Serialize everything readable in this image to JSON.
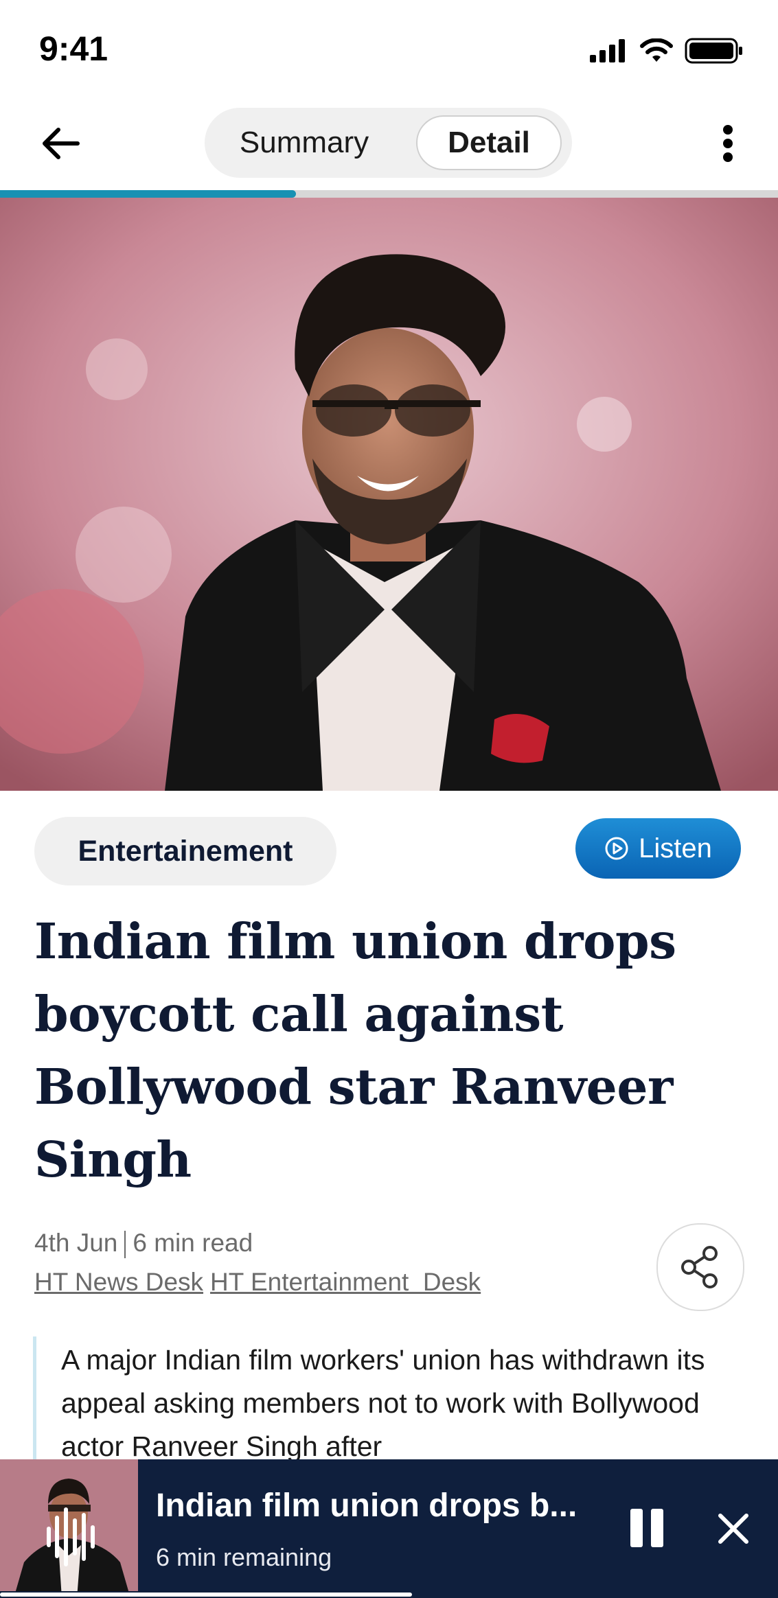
{
  "status_bar": {
    "time": "9:41"
  },
  "header": {
    "tabs": [
      {
        "label": "Summary",
        "selected": false
      },
      {
        "label": "Detail",
        "selected": true
      }
    ],
    "reading_progress_pct": 38
  },
  "article": {
    "category": "Entertainement",
    "listen_label": "Listen",
    "headline": "Indian film union drops boycott call against Bollywood star Ranveer Singh",
    "date": "4th Jun",
    "read_time": "6 min read",
    "authors": [
      "HT News Desk",
      "HT Entertainment  Desk"
    ],
    "body_intro": "A major Indian film workers' union has withdrawn its appeal asking members not to work with Bollywood actor Ranveer Singh after"
  },
  "player": {
    "title": "Indian film union drops b...",
    "remaining": "6 min remaining",
    "progress_pct": 53
  },
  "colors": {
    "navy": "#0f1f3d",
    "accent_blue": "#0a64b4",
    "progress_teal": "#1891b3"
  }
}
